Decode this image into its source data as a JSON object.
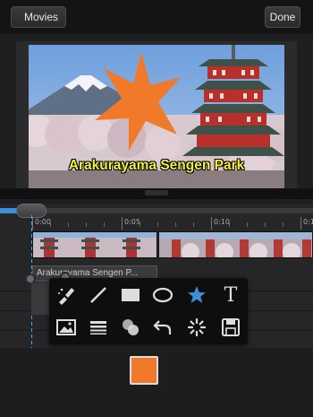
{
  "topbar": {
    "back_label": "Movies",
    "done_label": "Done"
  },
  "preview": {
    "caption": "Arakurayama Sengen Park",
    "star_color": "#f07a2a",
    "caption_color": "#f5f03a"
  },
  "timeline": {
    "ruler_labels": [
      "0:00",
      "0:05",
      "0:10",
      "0:15"
    ],
    "title_clip_label": "Arakurayama Sengen P...",
    "accent": "#3d8fd6"
  },
  "toolbox": {
    "row1": [
      "brush-tool",
      "line-tool",
      "rectangle-tool",
      "ellipse-tool",
      "star-tool",
      "text-tool"
    ],
    "row2": [
      "image-tool",
      "line-weight-tool",
      "blend-tool",
      "undo-tool",
      "clear-tool",
      "save-tool"
    ],
    "text_tool_glyph": "T"
  },
  "color_swatch": {
    "color": "#f07a2a"
  }
}
